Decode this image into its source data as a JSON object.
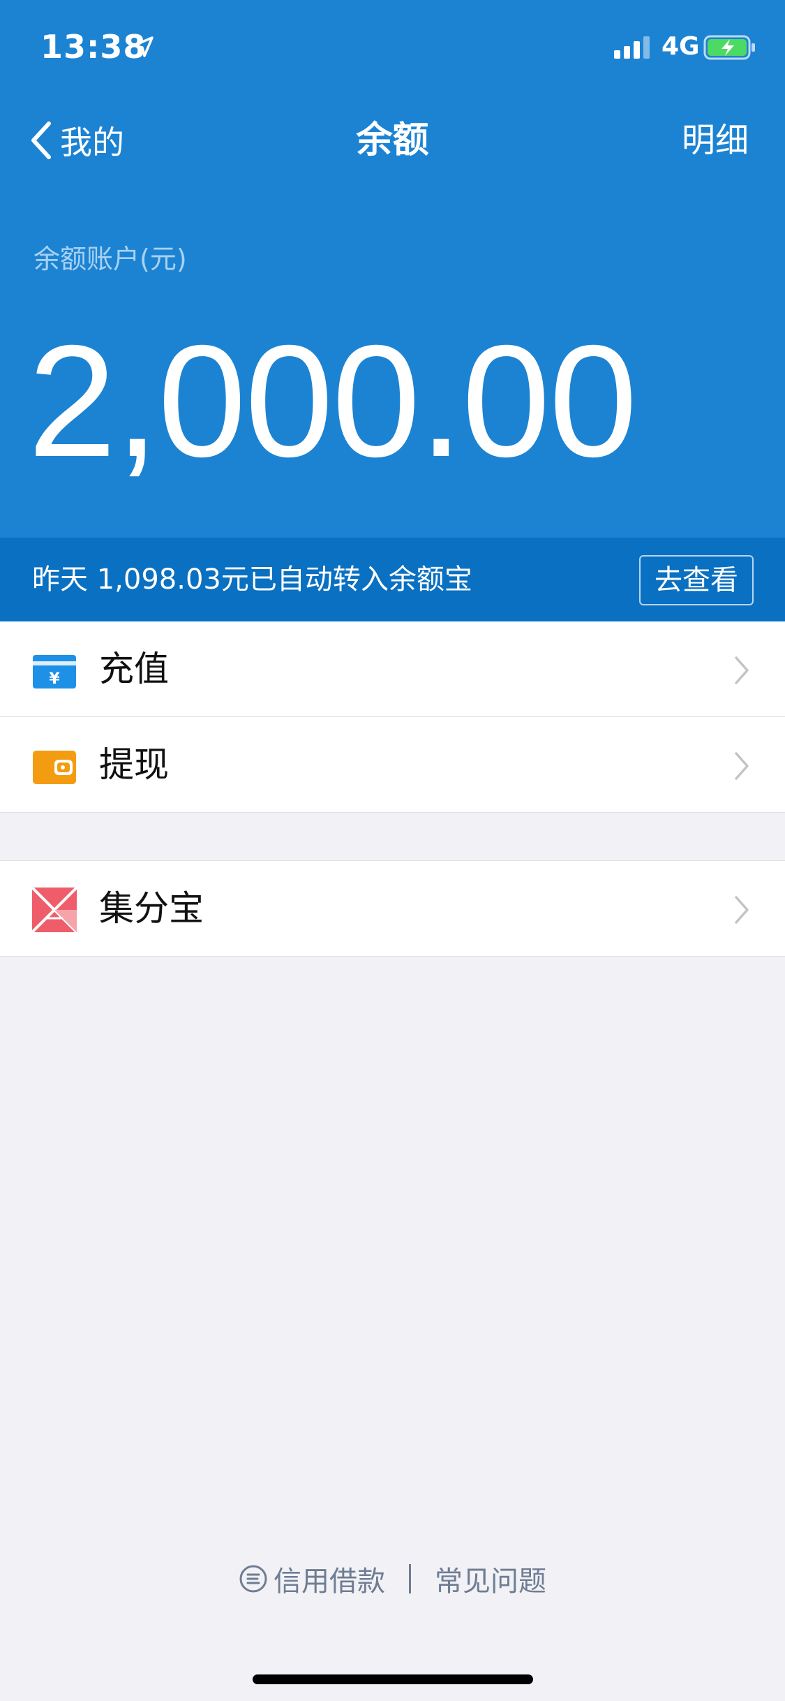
{
  "status_bar": {
    "time": "13:38",
    "network": "4G"
  },
  "nav": {
    "back_label": "我的",
    "title": "余额",
    "detail_label": "明细"
  },
  "balance": {
    "label": "余额账户(元)",
    "amount": "2,000.00"
  },
  "notice": {
    "text": "昨天 1,098.03元已自动转入余额宝",
    "button_label": "去查看"
  },
  "menu_group_1": [
    {
      "label": "充值",
      "icon": "recharge-icon"
    },
    {
      "label": "提现",
      "icon": "withdraw-wallet-icon"
    }
  ],
  "menu_group_2": [
    {
      "label": "集分宝",
      "icon": "jifenbao-icon"
    }
  ],
  "footer": {
    "credit_link": "信用借款",
    "faq_link": "常见问题"
  },
  "colors": {
    "header_blue": "#1c83d3",
    "notice_blue": "#0a70c1",
    "recharge_blue": "#1e90e6",
    "withdraw_orange": "#f39c12",
    "jifenbao_red": "#ef5d6a"
  }
}
